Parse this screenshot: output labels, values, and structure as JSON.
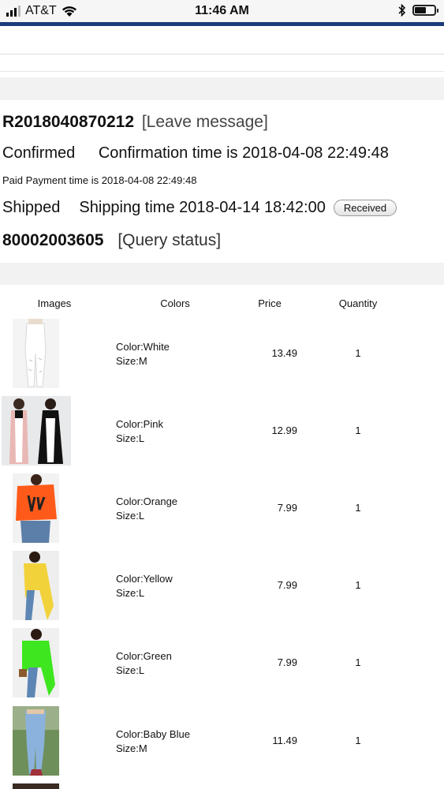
{
  "status_bar": {
    "carrier": "AT&T",
    "time": "11:46 AM"
  },
  "order": {
    "number": "R2018040870212",
    "leave_message": "[Leave message]",
    "confirmed_label": "Confirmed",
    "confirmation_time": "Confirmation time is 2018-04-08 22:49:48",
    "paid_text": "Paid Payment time is 2018-04-08 22:49:48",
    "shipped_label": "Shipped",
    "shipping_time": "Shipping time 2018-04-14 18:42:00",
    "received_button": "Received",
    "tracking_number": "80002003605",
    "query_status": "[Query status]"
  },
  "table": {
    "headers": {
      "images": "Images",
      "colors": "Colors",
      "price": "Price",
      "quantity": "Quantity"
    },
    "items": [
      {
        "color": "Color:White",
        "size": "Size:M",
        "price": "13.49",
        "qty": "1",
        "image": "white-jeans-photo"
      },
      {
        "color": "Color:Pink",
        "size": "Size:L",
        "price": "12.99",
        "qty": "1",
        "image": "pink-cardigan-photo"
      },
      {
        "color": "Color:Orange",
        "size": "Size:L",
        "price": "7.99",
        "qty": "1",
        "image": "orange-sweater-photo"
      },
      {
        "color": "Color:Yellow",
        "size": "Size:L",
        "price": "7.99",
        "qty": "1",
        "image": "yellow-top-photo"
      },
      {
        "color": "Color:Green",
        "size": "Size:L",
        "price": "7.99",
        "qty": "1",
        "image": "green-top-photo"
      },
      {
        "color": "Color:Baby Blue",
        "size": "Size:M",
        "price": "11.49",
        "qty": "1",
        "image": "blue-jeans-photo"
      }
    ]
  },
  "colors": {
    "brand_bar": "#1b3c7a",
    "band": "#f2f2f2"
  }
}
